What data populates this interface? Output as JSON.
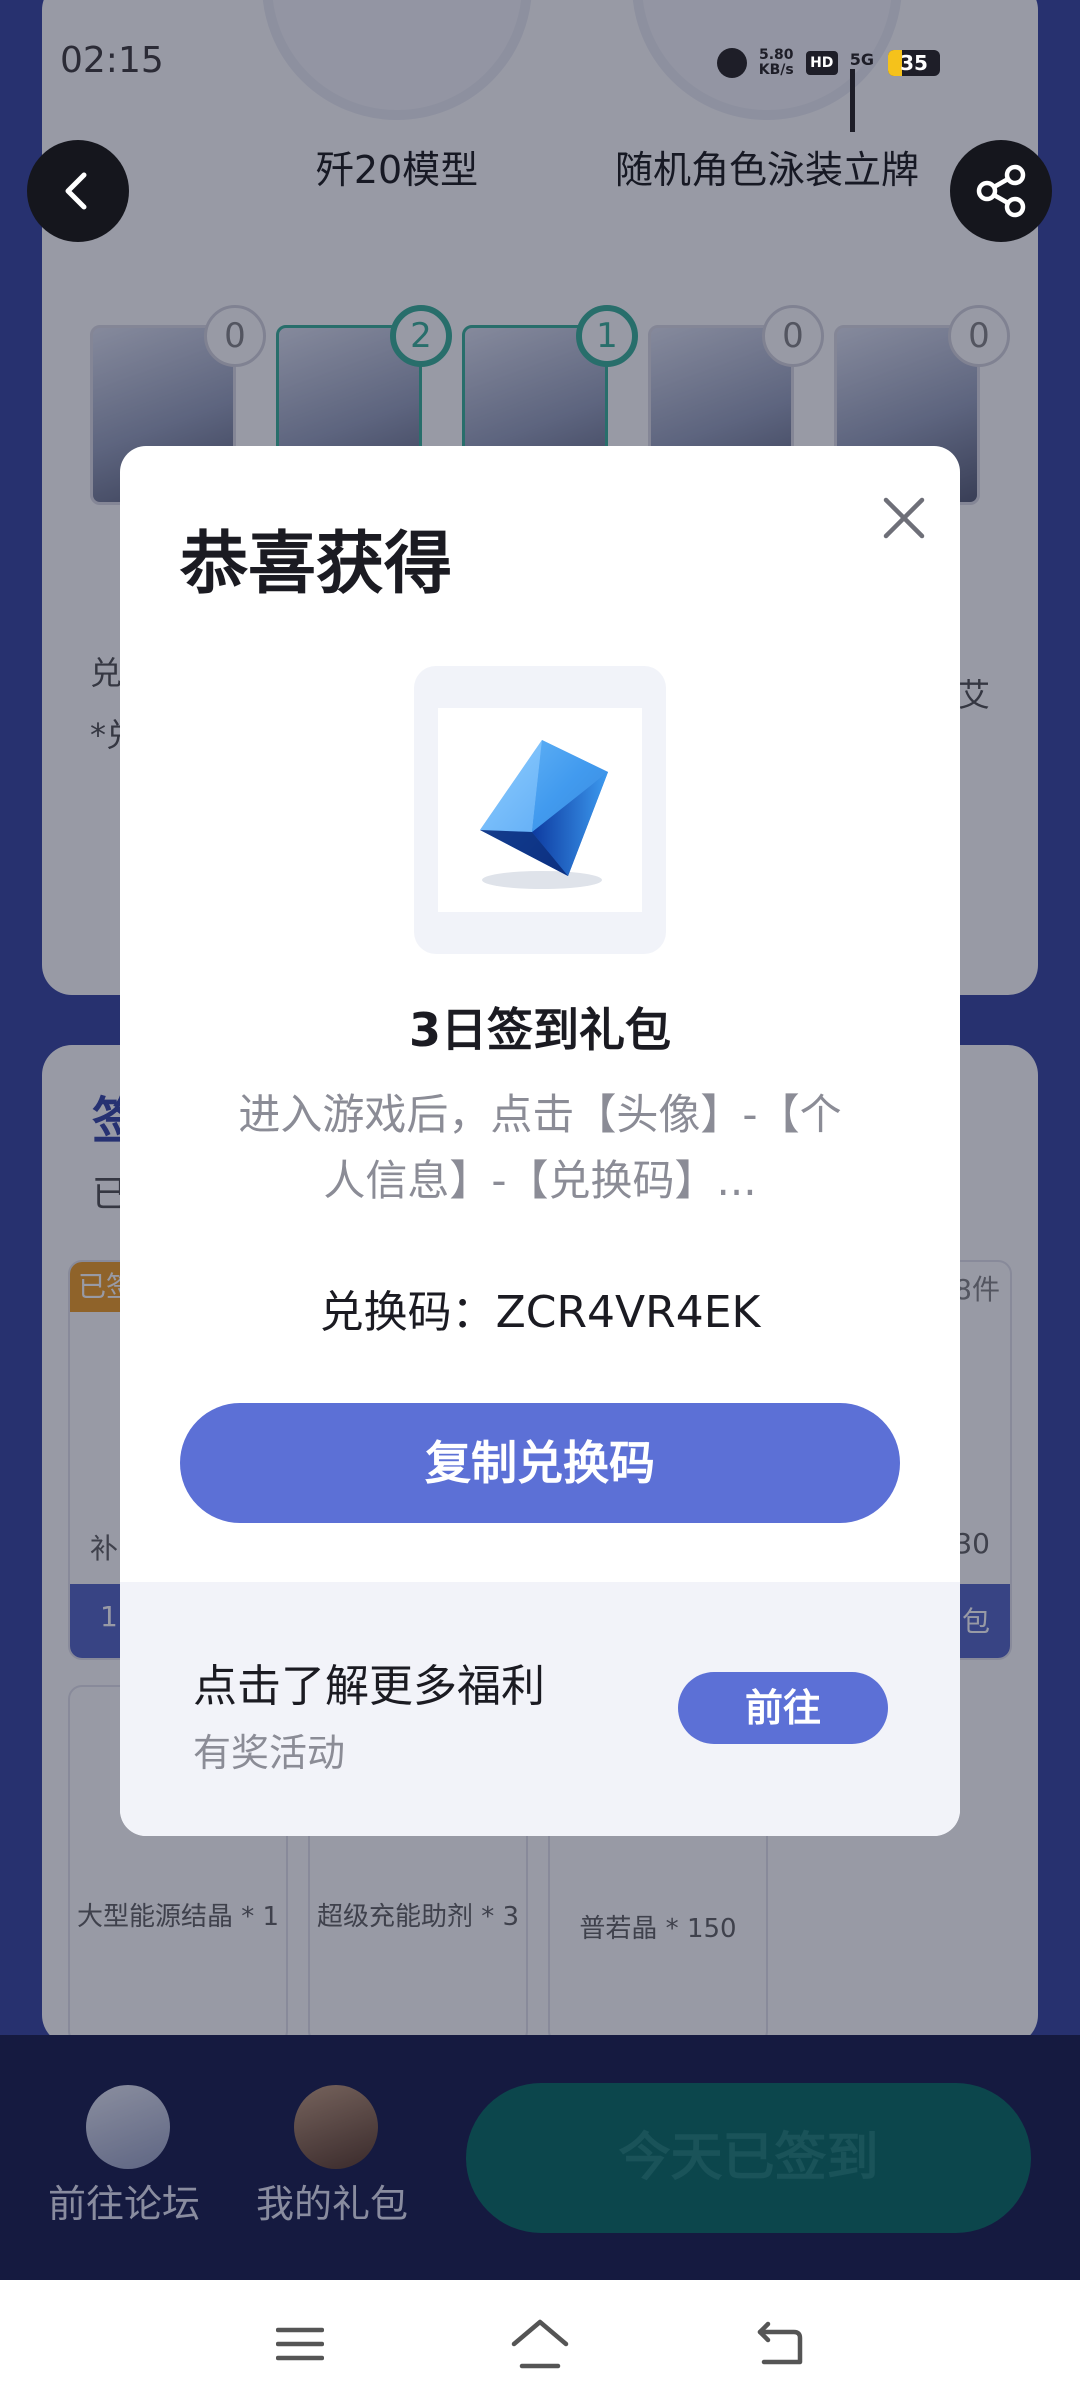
{
  "status_bar": {
    "time": "02:15",
    "net_speed_value": "5.80",
    "net_speed_unit": "KB/s",
    "hd": "HD",
    "network": "5G",
    "battery": "35"
  },
  "background": {
    "prizes": [
      {
        "name": "歼20模型"
      },
      {
        "name": "随机角色泳装立牌"
      }
    ],
    "character_counts": [
      "0",
      "2",
      "1",
      "0",
      "0"
    ],
    "fragment_text_left_1": "兑",
    "fragment_text_left_2": "*兑",
    "fragment_text_right": "艾",
    "sign_section": {
      "title": "签",
      "subtitle": "已",
      "tag_left": "已签",
      "tag_right": "8件",
      "frag_left_2": "补",
      "frag_right_2": "30",
      "frag_left_3": "1",
      "frag_right_3": "包"
    },
    "gifts": [
      {
        "name": "大型能源结晶 * 1"
      },
      {
        "name": "超级充能助剂 * 3"
      },
      {
        "name": "普若晶 * 150"
      }
    ]
  },
  "bottom_nav": {
    "forum_label": "前往论坛",
    "gifts_label": "我的礼包",
    "signed_label": "今天已签到"
  },
  "modal": {
    "title": "恭喜获得",
    "gift_title": "3日签到礼包",
    "gift_desc": "进入游戏后，点击【头像】-【个人信息】-【兑换码】...",
    "code_line": "兑换码：ZCR4VR4EK",
    "copy_button": "复制兑换码",
    "footer_title": "点击了解更多福利",
    "footer_sub": "有奖活动",
    "go_button": "前往"
  },
  "colors": {
    "accent": "#5c70d6",
    "page_bg": "#3d4ba3",
    "teal": "#3fb39b"
  },
  "icons": {
    "back": "chevron-left-icon",
    "share": "share-icon",
    "close": "close-icon",
    "gift": "blue-crystal-icon",
    "menu": "menu-icon",
    "home": "home-icon",
    "return": "back-icon"
  }
}
